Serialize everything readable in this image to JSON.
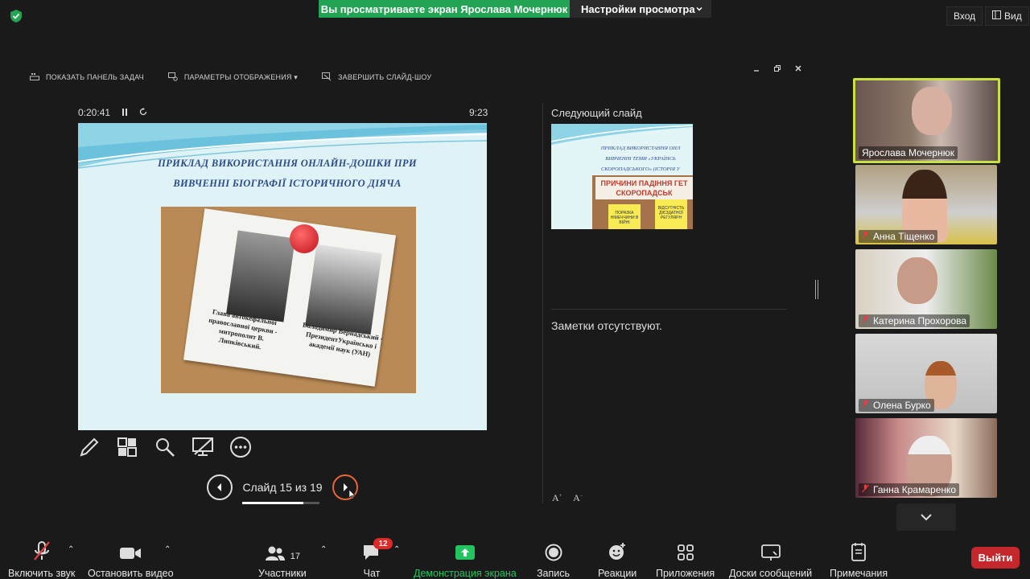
{
  "top": {
    "share_banner": "Вы просматриваете экран Ярослава Мочернюк",
    "view_settings": "Настройки просмотра",
    "login": "Вход",
    "view": "Вид"
  },
  "presenter_toolbar": {
    "show_taskbar": "ПОКАЗАТЬ ПАНЕЛЬ ЗАДАЧ",
    "display_settings": "ПАРАМЕТРЫ ОТОБРАЖЕНИЯ ▾",
    "end_slideshow": "ЗАВЕРШИТЬ СЛАЙД-ШОУ"
  },
  "slideshow": {
    "elapsed": "0:20:41",
    "clock": "9:23",
    "slide_title_line1": "ПРИКЛАД ВИКОРИСТАННЯ ОНЛАЙН-ДОШКИ ПРИ",
    "slide_title_line2": "ВИВЧЕННІ БІОГРАФІЇ ІСТОРИЧНОГО ДІЯЧА",
    "caption_left": "Глава автокефальної православної церкви - митрополит В. Липківський.",
    "caption_right": "Володимир Вернадський - ПрезидентУкраїнсько і академії наук (УАН)",
    "counter": "Слайд 15 из 19",
    "progress": 0.79
  },
  "next": {
    "label": "Следующий слайд",
    "preview_line1": "ПРИКЛАД ВИКОРИСТАННЯ ОНЛ",
    "preview_line2": "ВИВЧЕННІ ТЕМИ «УКРАЇНСЬ",
    "preview_line3": "СКОРОПАДСЬКОГО» (ІСТОРІЯ У",
    "preview_header": "ПРИЧИНИ ПАДІННЯ ГЕТ СКОРОПАДСЬК",
    "preview_note1": "ПОРАЗКА НІМЕЧЧИНИ В ВІЙНІ",
    "preview_note2": "ВІДСУТНІСТЬ ДІЄЗДАТНОЇ РЕГУЛЯРН"
  },
  "notes": {
    "text": "Заметки отсутствуют.",
    "font_up": "A",
    "font_down": "A"
  },
  "participants": [
    {
      "name": "Ярослава Мочернюк",
      "muted": false
    },
    {
      "name": "Анна Тіщенко",
      "muted": true
    },
    {
      "name": "Катерина Прохорова",
      "muted": true
    },
    {
      "name": "Олена Бурко",
      "muted": true
    },
    {
      "name": "Ганна Крамаренко",
      "muted": true
    }
  ],
  "bottom": {
    "unmute": "Включить звук",
    "stop_video": "Остановить видео",
    "participants": "Участники",
    "participants_count": "17",
    "chat": "Чат",
    "chat_badge": "12",
    "share": "Демонстрация экрана",
    "record": "Запись",
    "reactions": "Реакции",
    "apps": "Приложения",
    "whiteboards": "Доски сообщений",
    "notes": "Примечания",
    "leave": "Выйти"
  },
  "colors": {
    "share_green": "#23a455",
    "active_speaker": "#c9e041",
    "leave_red": "#c5272c",
    "badge_red": "#e02828"
  }
}
